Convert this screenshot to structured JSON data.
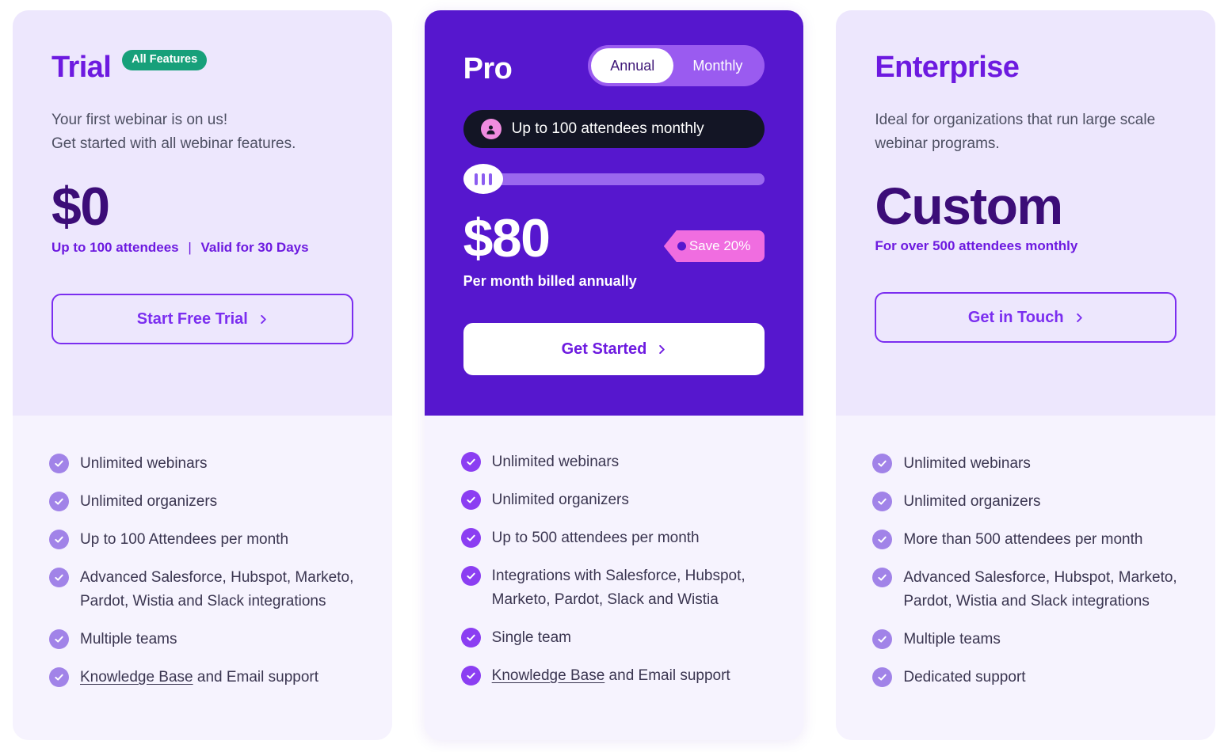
{
  "colors": {
    "brand_violet": "#6D1AE0",
    "featured_bg": "#5617CE",
    "card_head_bg": "#EDE7FD",
    "card_list_bg": "#F6F3FE",
    "price_dark": "#3C0D78",
    "badge_green": "#17A07A",
    "save_tag_pink": "#F06DE0",
    "attendee_pill": "#131525",
    "check_light": "#A183E8",
    "check_strong": "#8B3EF2"
  },
  "plans": [
    {
      "id": "trial",
      "title": "Trial",
      "badge": "All Features",
      "description": "Your first webinar is on us!\nGet started with all webinar features.",
      "price": "$0",
      "price_sub_left": "Up to 100 attendees",
      "price_sub_sep": "|",
      "price_sub_right": "Valid for 30 Days",
      "cta_label": "Start Free Trial",
      "features": [
        {
          "text": "Unlimited webinars"
        },
        {
          "text": "Unlimited organizers"
        },
        {
          "text": "Up to 100 Attendees per month"
        },
        {
          "text": "Advanced Salesforce, Hubspot, Marketo, Pardot, Wistia and Slack integrations"
        },
        {
          "text": "Multiple teams"
        },
        {
          "link": "Knowledge Base",
          "text": " and Email support"
        }
      ]
    },
    {
      "id": "pro",
      "title": "Pro",
      "toggle": {
        "options": [
          "Annual",
          "Monthly"
        ],
        "selected": "Annual"
      },
      "attendee_pill": "Up to 100 attendees monthly",
      "slider": {
        "value_percent": 0
      },
      "price": "$80",
      "price_sub": "Per month billed annually",
      "save_tag": "Save 20%",
      "cta_label": "Get Started",
      "features": [
        {
          "text": "Unlimited webinars"
        },
        {
          "text": "Unlimited organizers"
        },
        {
          "text": "Up to 500 attendees per month"
        },
        {
          "text": "Integrations with Salesforce, Hubspot, Marketo, Pardot, Slack and Wistia"
        },
        {
          "text": "Single team"
        },
        {
          "link": "Knowledge Base",
          "text": " and Email support"
        }
      ]
    },
    {
      "id": "enterprise",
      "title": "Enterprise",
      "description": "Ideal for organizations that run large scale webinar programs.",
      "price": "Custom",
      "price_sub": "For over 500 attendees monthly",
      "cta_label": "Get in Touch",
      "features": [
        {
          "text": "Unlimited webinars"
        },
        {
          "text": "Unlimited organizers"
        },
        {
          "text": "More than 500 attendees per month"
        },
        {
          "text": "Advanced Salesforce, Hubspot, Marketo, Pardot, Wistia and Slack integrations"
        },
        {
          "text": "Multiple teams"
        },
        {
          "text": "Dedicated support"
        }
      ]
    }
  ],
  "icons": {
    "check": "check-icon",
    "chevron_right": "chevron-right-icon",
    "avatar": "avatar-icon",
    "slider_handle": "slider-handle-icon"
  }
}
